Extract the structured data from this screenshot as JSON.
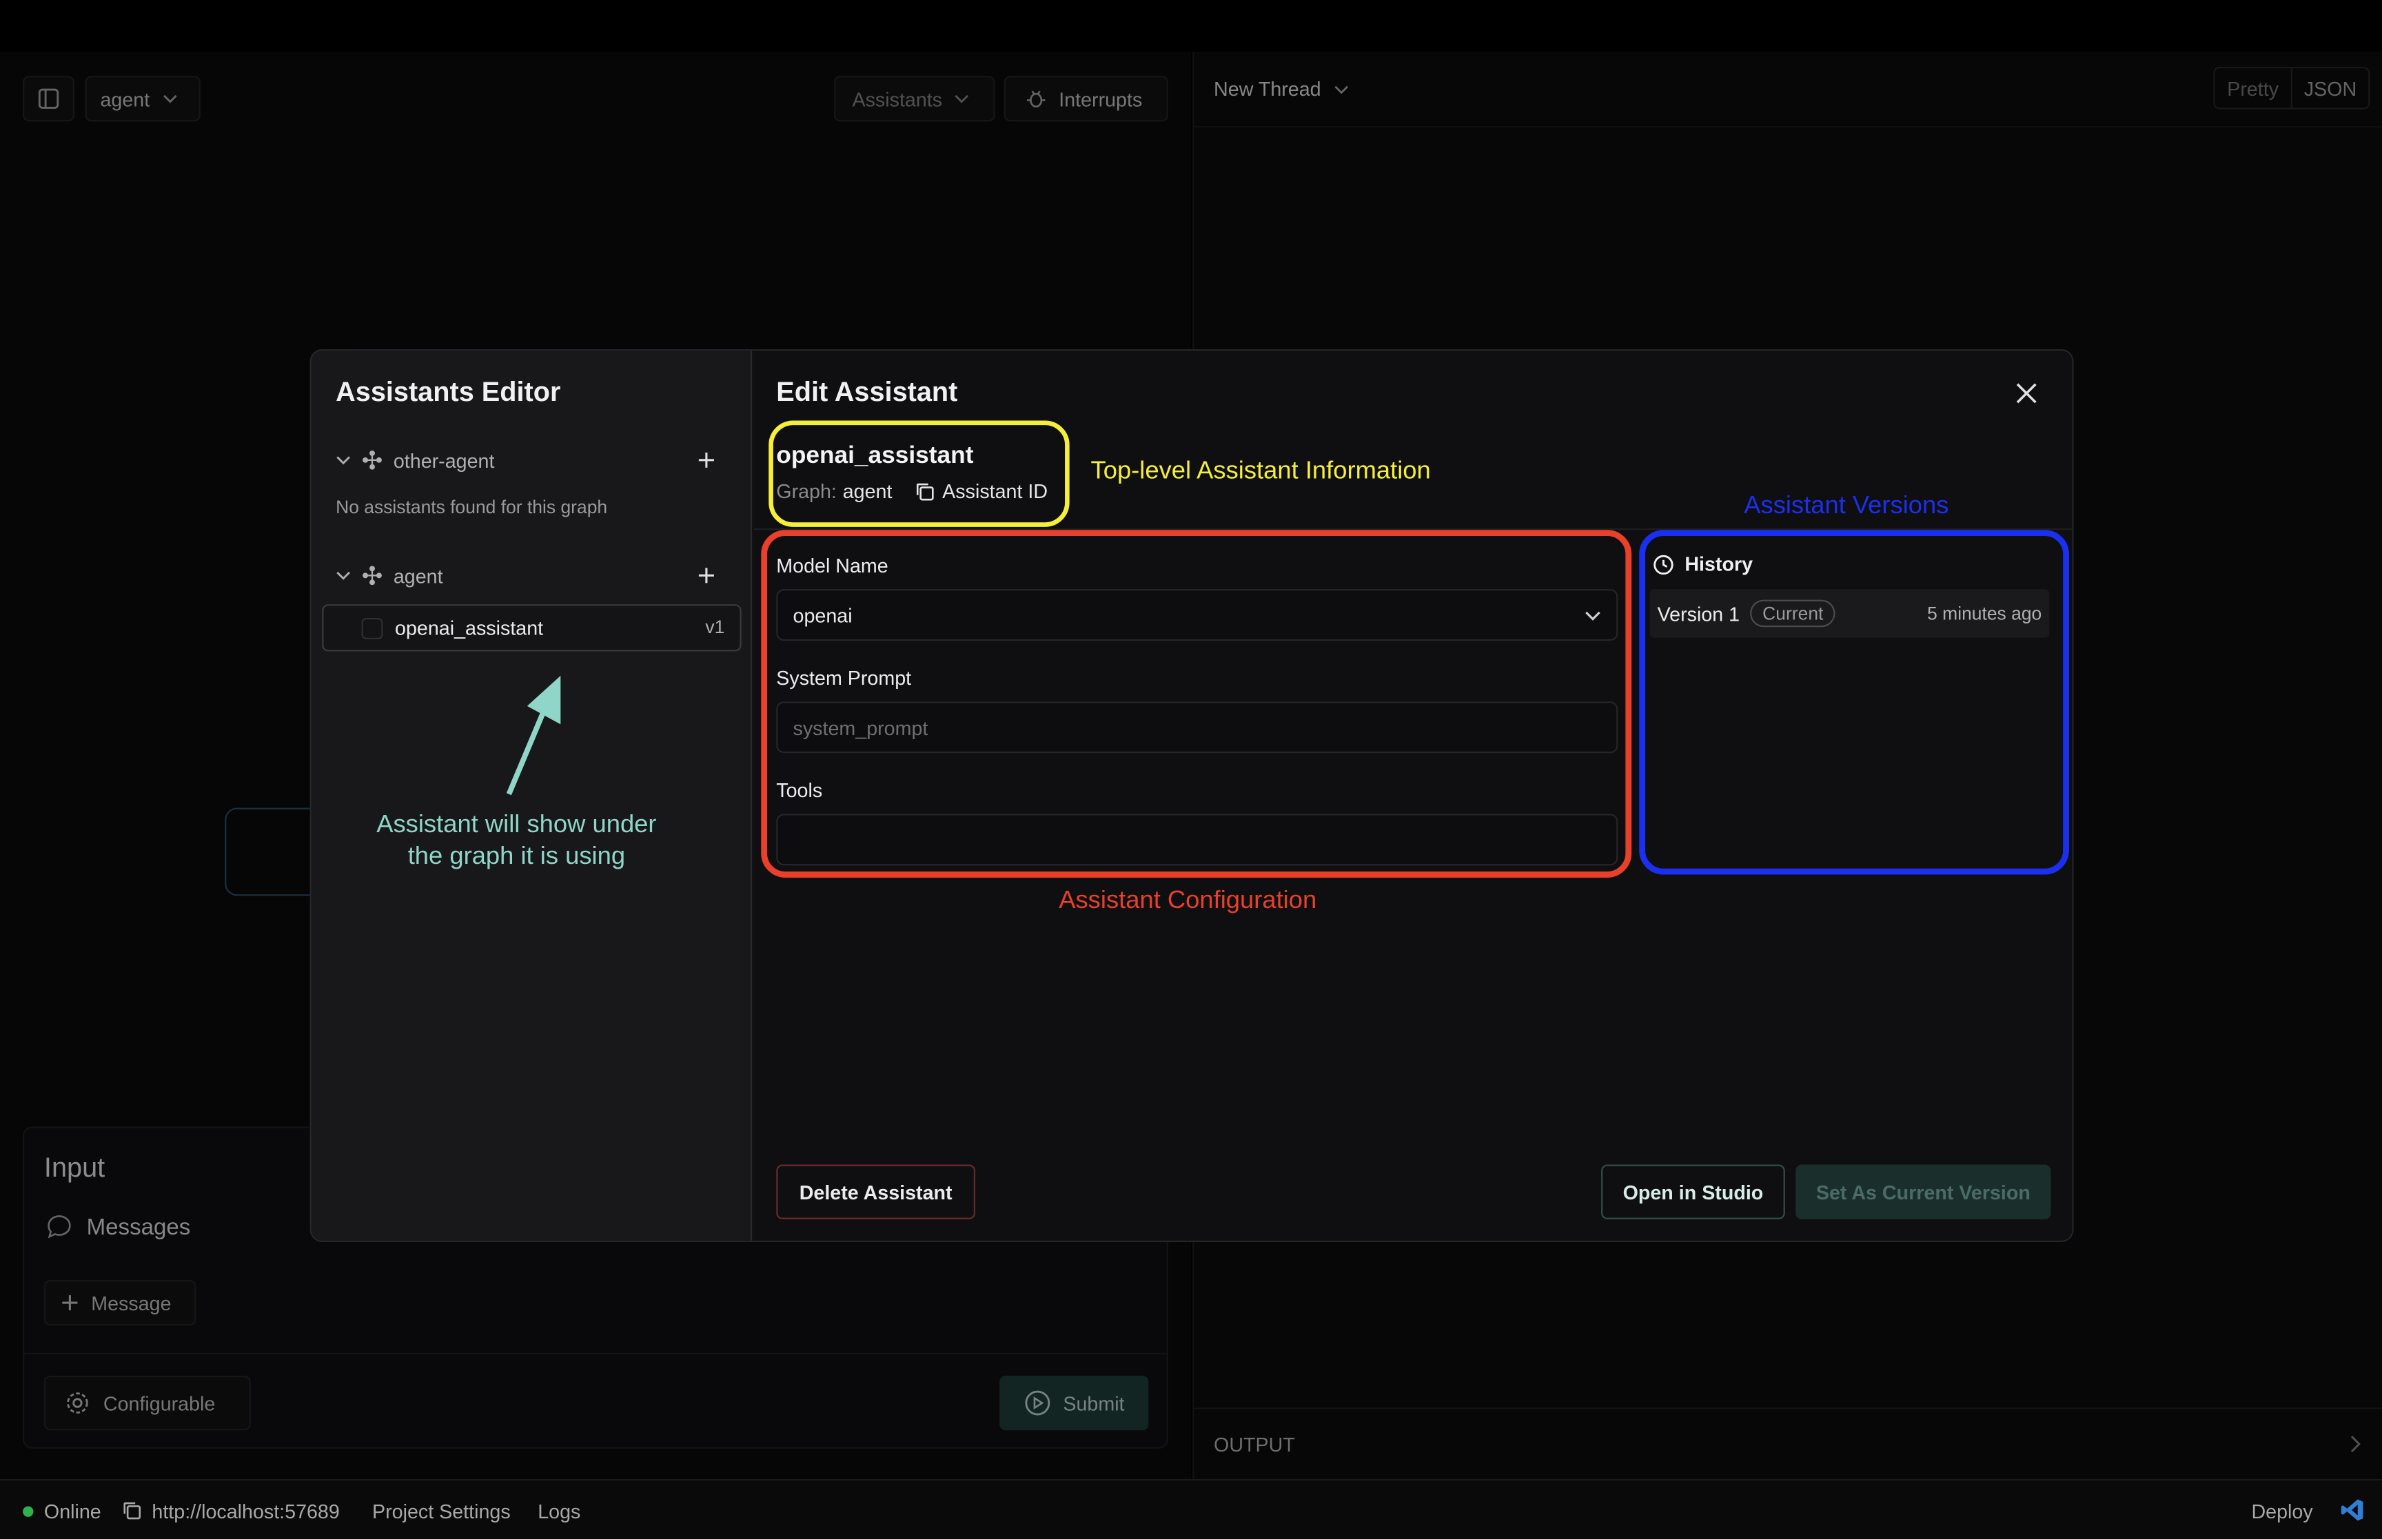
{
  "header": {
    "graph_select": "agent",
    "assistants_button": "Assistants",
    "interrupts_button": "Interrupts",
    "thread_title": "New Thread",
    "view_pretty": "Pretty",
    "view_json": "JSON"
  },
  "input_panel": {
    "title": "Input",
    "messages_label": "Messages",
    "add_message": "Message",
    "configurable": "Configurable",
    "submit": "Submit"
  },
  "output": {
    "label": "OUTPUT"
  },
  "status_bar": {
    "online": "Online",
    "url": "http://localhost:57689",
    "project_settings": "Project Settings",
    "logs": "Logs",
    "deploy": "Deploy"
  },
  "editor": {
    "title": "Assistants Editor",
    "groups": [
      {
        "name": "other-agent",
        "empty_text": "No assistants found for this graph"
      },
      {
        "name": "agent",
        "items": [
          {
            "name": "openai_assistant",
            "version": "v1"
          }
        ]
      }
    ]
  },
  "edit": {
    "title": "Edit Assistant",
    "assistant_name": "openai_assistant",
    "graph_label": "Graph:",
    "graph_value": "agent",
    "assistant_id_label": "Assistant ID",
    "model_name_label": "Model Name",
    "model_name_value": "openai",
    "system_prompt_label": "System Prompt",
    "system_prompt_placeholder": "system_prompt",
    "tools_label": "Tools",
    "history": {
      "title": "History",
      "versions": [
        {
          "name": "Version 1",
          "badge": "Current",
          "time": "5 minutes ago"
        }
      ]
    },
    "delete_button": "Delete Assistant",
    "open_studio_button": "Open in Studio",
    "set_current_button": "Set As Current Version"
  },
  "annotations": {
    "top_level": "Top-level Assistant Information",
    "versions": "Assistant Versions",
    "configuration": "Assistant Configuration",
    "graph_hint_line1": "Assistant will show under",
    "graph_hint_line2": "the graph it is using"
  },
  "colors": {
    "yellow": "#f5ef3a",
    "red": "#e8402a",
    "blue": "#1b2ff0",
    "teal": "#8fd6c8",
    "submit_bg": "#1c3a36"
  }
}
